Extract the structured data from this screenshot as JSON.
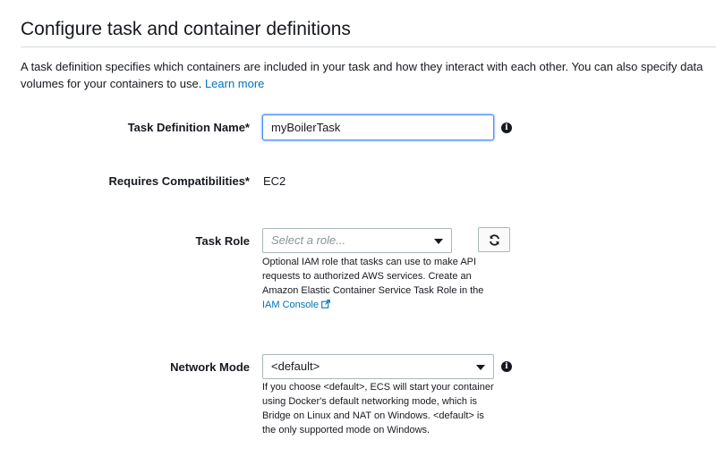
{
  "section": {
    "title": "Configure task and container definitions",
    "intro_line1": "A task definition specifies which containers are included in your task and how they interact with each other. You can also specify data",
    "intro_line2": "volumes for your containers to use. ",
    "learn_more": "Learn more"
  },
  "task_definition_name": {
    "label": "Task Definition Name*",
    "value": "myBoilerTask",
    "info_icon": "info-icon"
  },
  "requires_compatibilities": {
    "label": "Requires Compatibilities*",
    "value": "EC2"
  },
  "task_role": {
    "label": "Task Role",
    "placeholder": "Select a role...",
    "refresh_icon": "refresh-icon",
    "help_text": "Optional IAM role that tasks can use to make API requests to authorized AWS services. Create an Amazon Elastic Container Service Task Role in the",
    "help_link": "IAM Console",
    "help_link_icon": "external-link-icon"
  },
  "network_mode": {
    "label": "Network Mode",
    "selected": "<default>",
    "info_icon": "info-icon",
    "help_text": "If you choose <default>, ECS will start your container using Docker's default networking mode, which is Bridge on Linux and NAT on Windows. <default> is the only supported mode on Windows."
  },
  "colors": {
    "text": "#16191f",
    "link": "#0073bb",
    "focus_border": "#4d90fe",
    "field_border": "#aab7b8"
  }
}
